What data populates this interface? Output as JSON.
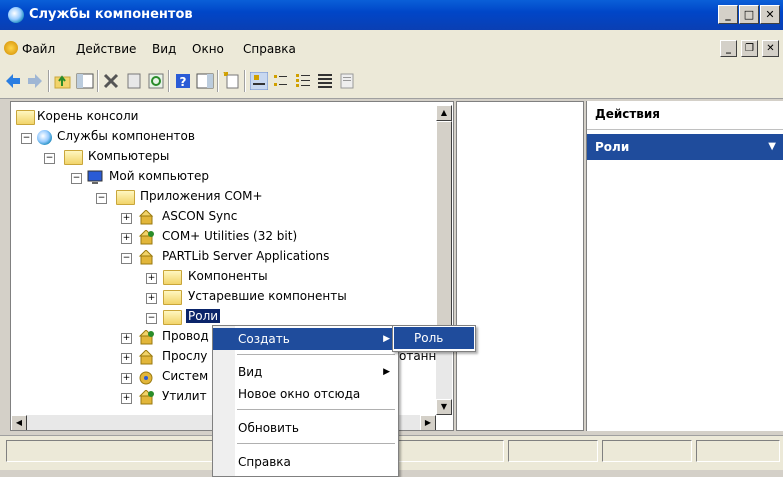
{
  "window": {
    "title": "Службы компонентов"
  },
  "menu": [
    "Файл",
    "Действие",
    "Вид",
    "Окно",
    "Справка"
  ],
  "tree": {
    "root": "Корень консоли",
    "component_services": "Службы компонентов",
    "computers": "Компьютеры",
    "my_computer": "Мой компьютер",
    "com_apps": "Приложения COM+",
    "ascon_sync": "ASCON Sync",
    "com_utilities": "COM+ Utilities (32 bit)",
    "partlib": "PARTLib Server Applications",
    "components": "Компоненты",
    "legacy_components": "Устаревшие компоненты",
    "roles": "Роли",
    "provod": "Провод",
    "prosl": "Прослу",
    "sistem": "Систем",
    "utilit": "Утилит",
    "partial_right": "отанн"
  },
  "actions": {
    "header": "Действия",
    "section": "Роли"
  },
  "context_menu": {
    "create": "Создать",
    "view": "Вид",
    "new_window": "Новое окно отсюда",
    "refresh": "Обновить",
    "help": "Справка"
  },
  "submenu": {
    "role": "Роль"
  },
  "colors": {
    "title_bar": "#0046c8",
    "highlight": "#1f4c9c",
    "selection": "#0a246a"
  }
}
